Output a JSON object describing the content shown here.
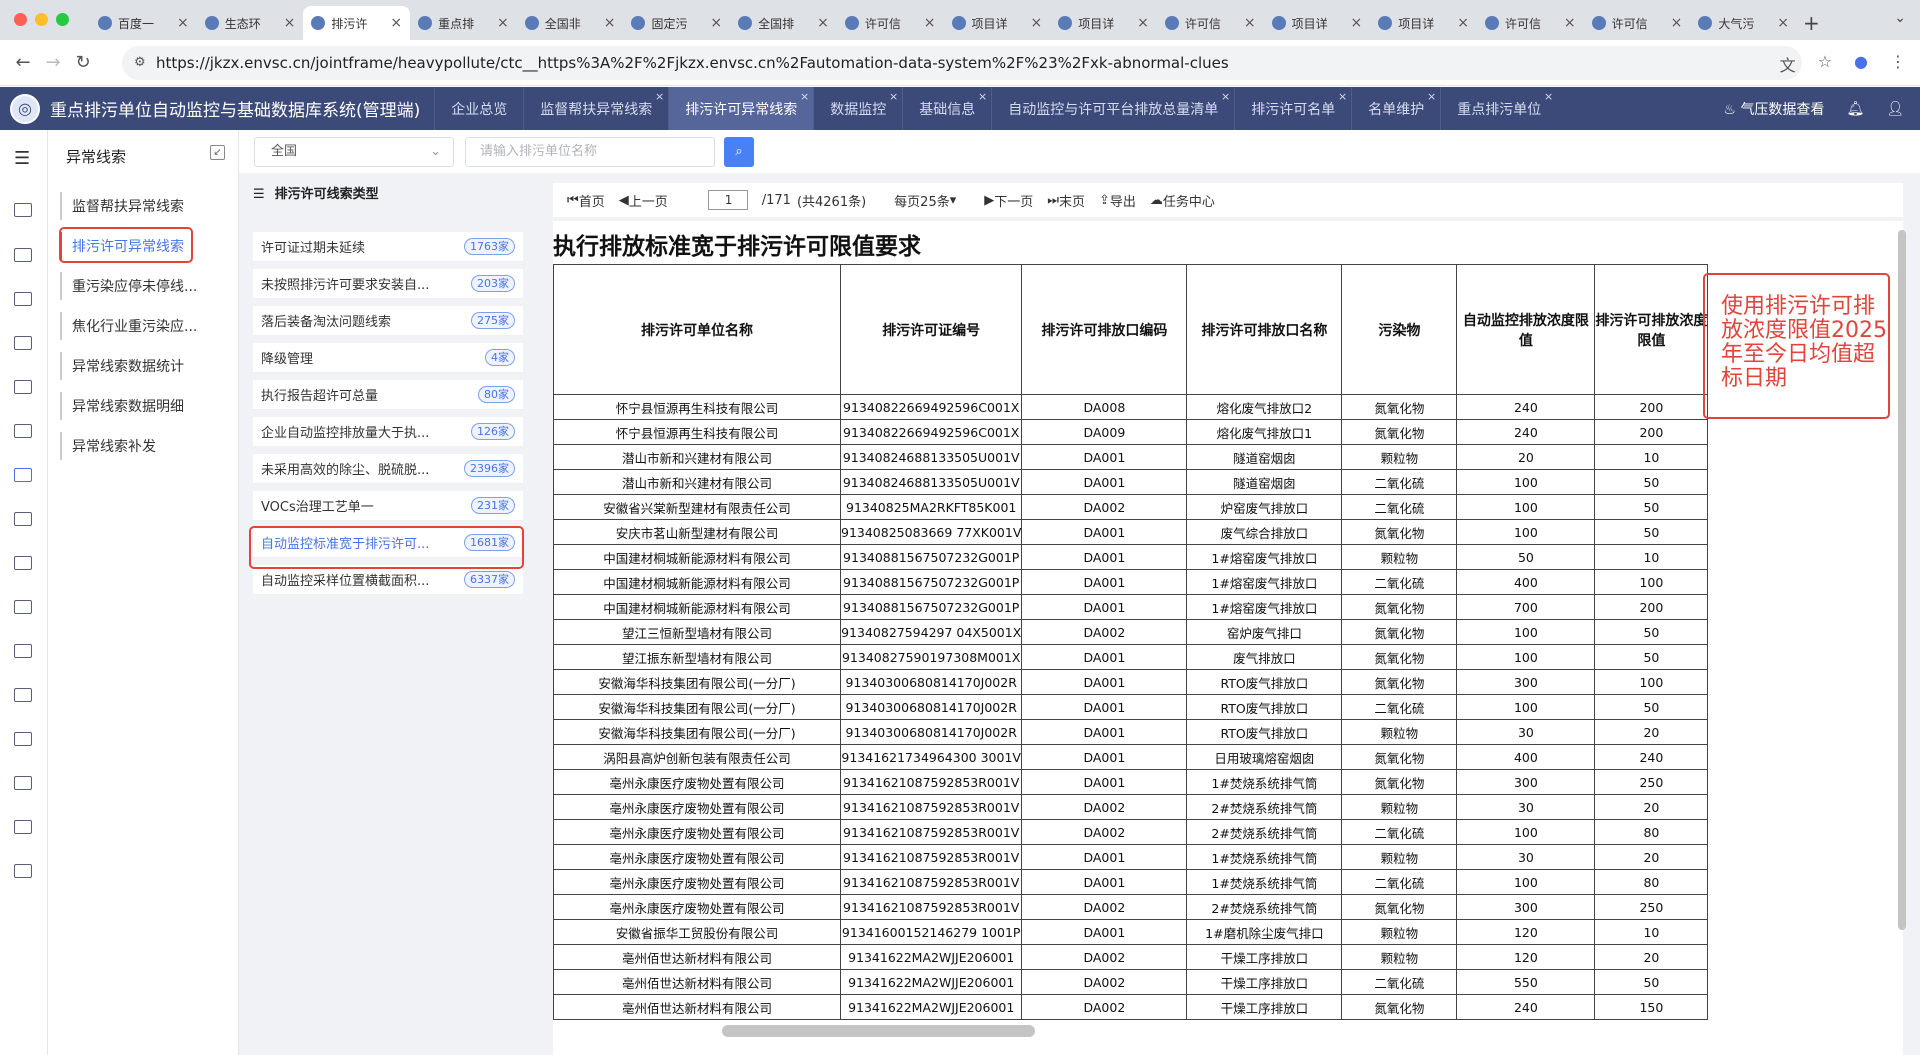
{
  "browser": {
    "tabs": [
      {
        "title": "百度一"
      },
      {
        "title": "生态环"
      },
      {
        "title": "排污许",
        "active": true
      },
      {
        "title": "重点排"
      },
      {
        "title": "全国非"
      },
      {
        "title": "固定污"
      },
      {
        "title": "全国排"
      },
      {
        "title": "许可信"
      },
      {
        "title": "项目详"
      },
      {
        "title": "项目详"
      },
      {
        "title": "许可信"
      },
      {
        "title": "项目详"
      },
      {
        "title": "项目详"
      },
      {
        "title": "许可信"
      },
      {
        "title": "许可信"
      },
      {
        "title": "大气污"
      }
    ],
    "url": "https://jkzx.envsc.cn/jointframe/heavypollute/ctc__https%3A%2F%2Fjkzx.envsc.cn%2Fautomation-data-system%2F%23%2Fxk-abnormal-clues"
  },
  "app": {
    "title": "重点排污单位自动监控与基础数据库系统(管理端)",
    "tabs": [
      {
        "label": "企业总览"
      },
      {
        "label": "监督帮扶异常线索"
      },
      {
        "label": "排污许可异常线索",
        "active": true
      },
      {
        "label": "数据监控"
      },
      {
        "label": "基础信息"
      },
      {
        "label": "自动监控与许可平台排放总量清单"
      },
      {
        "label": "排污许可名单"
      },
      {
        "label": "名单维护"
      },
      {
        "label": "重点排污单位"
      }
    ],
    "pressure_link": "气压数据查看"
  },
  "left_panel": {
    "title": "异常线索",
    "items": [
      {
        "label": "监督帮扶异常线索"
      },
      {
        "label": "排污许可异常线索",
        "active": true
      },
      {
        "label": "重污染应停未停线..."
      },
      {
        "label": "焦化行业重污染应..."
      },
      {
        "label": "异常线索数据统计"
      },
      {
        "label": "异常线索数据明细"
      },
      {
        "label": "异常线索补发"
      }
    ]
  },
  "filter": {
    "region": "全国",
    "search_placeholder": "请输入排污单位名称"
  },
  "type_panel": {
    "title": "排污许可线索类型",
    "items": [
      {
        "label": "许可证过期未延续",
        "count": "1763家"
      },
      {
        "label": "未按照排污许可要求安装自...",
        "count": "203家"
      },
      {
        "label": "落后装备淘汰问题线索",
        "count": "275家"
      },
      {
        "label": "降级管理",
        "count": "4家"
      },
      {
        "label": "执行报告超许可总量",
        "count": "80家"
      },
      {
        "label": "企业自动监控排放量大于执...",
        "count": "126家"
      },
      {
        "label": "未采用高效的除尘、脱硫脱...",
        "count": "2396家"
      },
      {
        "label": "VOCs治理工艺单一",
        "count": "231家"
      },
      {
        "label": "自动监控标准宽于排污许可...",
        "count": "1681家",
        "active": true
      },
      {
        "label": "自动监控采样位置横截面积...",
        "count": "6337家"
      }
    ]
  },
  "pager": {
    "first": "首页",
    "prev": "上一页",
    "page": "1",
    "total": "/171",
    "count": "(共4261条)",
    "per_page": "每页25条",
    "next": "下一页",
    "last": "末页",
    "export": "导出",
    "task_center": "任务中心"
  },
  "report": {
    "title": "执行排放标准宽于排污许可限值要求",
    "columns": [
      "排污许可单位名称",
      "排污许可证编号",
      "排污许可排放口编码",
      "排污许可排放口名称",
      "污染物",
      "自动监控排放浓度限值",
      "排污许可排放浓度限值"
    ],
    "rows": [
      [
        "怀宁县恒源再生科技有限公司",
        "91340822669492596C001X",
        "DA008",
        "熔化废气排放口2",
        "氮氧化物",
        "240",
        "200"
      ],
      [
        "怀宁县恒源再生科技有限公司",
        "91340822669492596C001X",
        "DA009",
        "熔化废气排放口1",
        "氮氧化物",
        "240",
        "200"
      ],
      [
        "潜山市新和兴建材有限公司",
        "91340824688133505U001V",
        "DA001",
        "隧道窑烟囱",
        "颗粒物",
        "20",
        "10"
      ],
      [
        "潜山市新和兴建材有限公司",
        "91340824688133505U001V",
        "DA001",
        "隧道窑烟囱",
        "二氧化硫",
        "100",
        "50"
      ],
      [
        "安徽省兴棠新型建材有限责任公司",
        "91340825MA2RKFT85K001",
        "DA002",
        "炉窑废气排放口",
        "二氧化硫",
        "100",
        "50"
      ],
      [
        "安庆市茗山新型建材有限公司",
        "91340825083669 77XK001V",
        "DA001",
        "废气综合排放口",
        "氮氧化物",
        "100",
        "50"
      ],
      [
        "中国建材桐城新能源材料有限公司",
        "91340881567507232G001P",
        "DA001",
        "1#熔窑废气排放口",
        "颗粒物",
        "50",
        "10"
      ],
      [
        "中国建材桐城新能源材料有限公司",
        "91340881567507232G001P",
        "DA001",
        "1#熔窑废气排放口",
        "二氧化硫",
        "400",
        "100"
      ],
      [
        "中国建材桐城新能源材料有限公司",
        "91340881567507232G001P",
        "DA001",
        "1#熔窑废气排放口",
        "氮氧化物",
        "700",
        "200"
      ],
      [
        "望江三恒新型墙材有限公司",
        "91340827594297 04X5001X",
        "DA002",
        "窑炉废气排口",
        "氮氧化物",
        "100",
        "50"
      ],
      [
        "望江振东新型墙材有限公司",
        "91340827590197308M001X",
        "DA001",
        "废气排放口",
        "氮氧化物",
        "100",
        "50"
      ],
      [
        "安徽海华科技集团有限公司(一分厂)",
        "91340300680814170J002R",
        "DA001",
        "RTO废气排放口",
        "氮氧化物",
        "300",
        "100"
      ],
      [
        "安徽海华科技集团有限公司(一分厂)",
        "91340300680814170J002R",
        "DA001",
        "RTO废气排放口",
        "二氧化硫",
        "100",
        "50"
      ],
      [
        "安徽海华科技集团有限公司(一分厂)",
        "91340300680814170J002R",
        "DA001",
        "RTO废气排放口",
        "颗粒物",
        "30",
        "20"
      ],
      [
        "涡阳县高炉创新包装有限责任公司",
        "91341621734964300 3001V",
        "DA001",
        "日用玻璃熔窑烟囱",
        "氮氧化物",
        "400",
        "240"
      ],
      [
        "亳州永康医疗废物处置有限公司",
        "91341621087592853R001V",
        "DA001",
        "1#焚烧系统排气筒",
        "氮氧化物",
        "300",
        "250"
      ],
      [
        "亳州永康医疗废物处置有限公司",
        "91341621087592853R001V",
        "DA002",
        "2#焚烧系统排气筒",
        "颗粒物",
        "30",
        "20"
      ],
      [
        "亳州永康医疗废物处置有限公司",
        "91341621087592853R001V",
        "DA002",
        "2#焚烧系统排气筒",
        "二氧化硫",
        "100",
        "80"
      ],
      [
        "亳州永康医疗废物处置有限公司",
        "91341621087592853R001V",
        "DA001",
        "1#焚烧系统排气筒",
        "颗粒物",
        "30",
        "20"
      ],
      [
        "亳州永康医疗废物处置有限公司",
        "91341621087592853R001V",
        "DA001",
        "1#焚烧系统排气筒",
        "二氧化硫",
        "100",
        "80"
      ],
      [
        "亳州永康医疗废物处置有限公司",
        "91341621087592853R001V",
        "DA002",
        "2#焚烧系统排气筒",
        "氮氧化物",
        "300",
        "250"
      ],
      [
        "安徽省振华工贸股份有限公司",
        "91341600152146279 1001P",
        "DA001",
        "1#磨机除尘废气排口",
        "颗粒物",
        "120",
        "10"
      ],
      [
        "亳州佰世达新材料有限公司",
        "91341622MA2WJJE206001",
        "DA002",
        "干燥工序排放口",
        "颗粒物",
        "120",
        "20"
      ],
      [
        "亳州佰世达新材料有限公司",
        "91341622MA2WJJE206001",
        "DA002",
        "干燥工序排放口",
        "二氧化硫",
        "550",
        "50"
      ],
      [
        "亳州佰世达新材料有限公司",
        "91341622MA2WJJE206001",
        "DA002",
        "干燥工序排放口",
        "氮氧化物",
        "240",
        "150"
      ]
    ]
  },
  "annotation": "使用排污许可排放浓度限值2025年至今日均值超标日期",
  "colors": {
    "header_bg": "#3c4a7a",
    "accent": "#4a72e8",
    "highlight_red": "#e0443a"
  }
}
